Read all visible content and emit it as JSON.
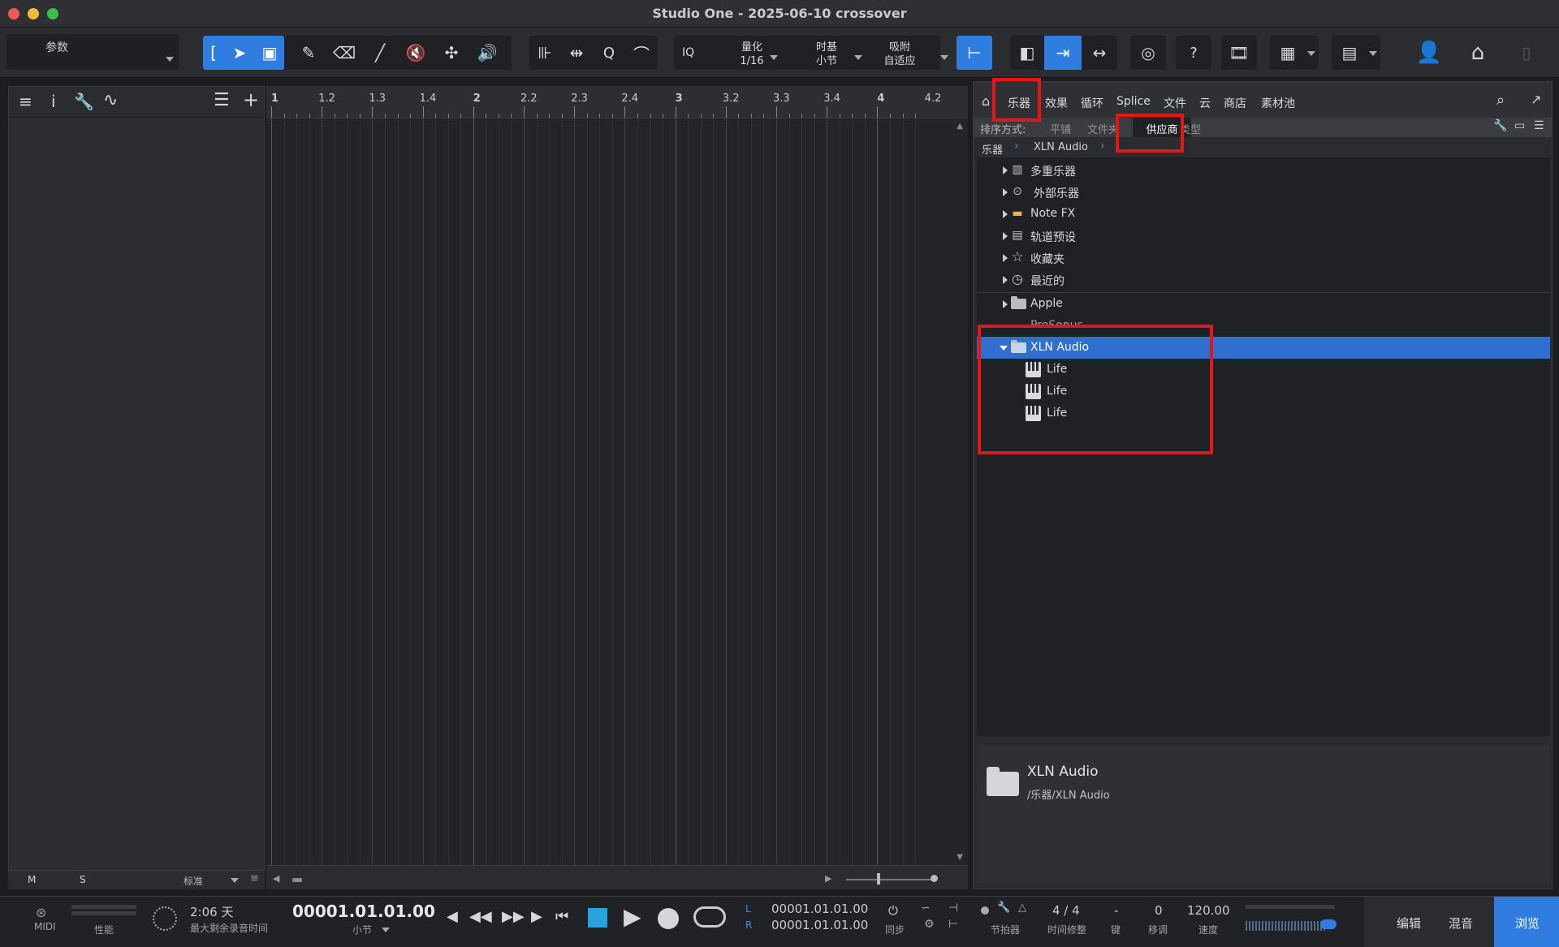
{
  "window": {
    "title": "Studio One - 2025-06-10 crossover"
  },
  "toolbar": {
    "params_label": "参数",
    "iq_label": "IQ",
    "quantize": {
      "label": "量化",
      "value": "1/16"
    },
    "timebase": {
      "label": "时基",
      "value": "小节"
    },
    "snap": {
      "label": "吸附",
      "value": "自适应"
    },
    "help_label": "?"
  },
  "ruler": {
    "labels": [
      "1",
      "1.2",
      "1.3",
      "1.4",
      "2",
      "2.2",
      "2.3",
      "2.4",
      "3",
      "3.2",
      "3.3",
      "3.4",
      "4",
      "4.2"
    ]
  },
  "arrange_footer": {
    "m": "M",
    "s": "S",
    "view": "标准"
  },
  "browser": {
    "tabs": [
      "乐器",
      "效果",
      "循环",
      "Splice",
      "文件",
      "云",
      "商店",
      "素材池"
    ],
    "sort_label": "排序方式:",
    "sort_options": [
      "平铺",
      "文件夹",
      "供应商",
      "类型"
    ],
    "breadcrumb": [
      "乐器",
      "XLN Audio"
    ],
    "tree": [
      {
        "label": "多重乐器",
        "icon": "multi-instrument-icon"
      },
      {
        "label": "外部乐器",
        "icon": "external-instrument-icon"
      },
      {
        "label": "Note FX",
        "icon": "note-fx-icon"
      },
      {
        "label": "轨道预设",
        "icon": "track-preset-icon"
      },
      {
        "label": "收藏夹",
        "icon": "star-icon"
      },
      {
        "label": "最近的",
        "icon": "clock-icon"
      },
      {
        "label": "Apple",
        "icon": "folder-icon"
      },
      {
        "label": "PreSonus",
        "icon": "folder-icon"
      },
      {
        "label": "XLN Audio",
        "icon": "folder-open-icon"
      },
      {
        "label": "Life",
        "icon": "keyboard-icon"
      },
      {
        "label": "Life",
        "icon": "keyboard-icon"
      },
      {
        "label": "Life",
        "icon": "keyboard-icon"
      }
    ],
    "info": {
      "name": "XLN Audio",
      "path": "/乐器/XLN Audio"
    }
  },
  "transport": {
    "midi_label": "MIDI",
    "perf_label": "性能",
    "record_time": "2:06 天",
    "record_time_label": "最大剩余录音时间",
    "position": "00001.01.01.00",
    "position_unit": "小节",
    "loop_l": "00001.01.01.00",
    "loop_r": "00001.01.01.00",
    "l_label": "L",
    "r_label": "R",
    "sync_label": "同步",
    "metronome_label": "节拍器",
    "signature": "4 / 4",
    "signature_label": "时间修整",
    "key": "-",
    "key_label": "键",
    "transpose": "0",
    "transpose_label": "移调",
    "tempo": "120.00",
    "tempo_label": "速度",
    "edit_label": "编辑",
    "mix_label": "混音",
    "browse_label": "浏览"
  },
  "colors": {
    "accent": "#2f7de1",
    "highlight": "#e01818",
    "selection": "#2f6fd0"
  }
}
